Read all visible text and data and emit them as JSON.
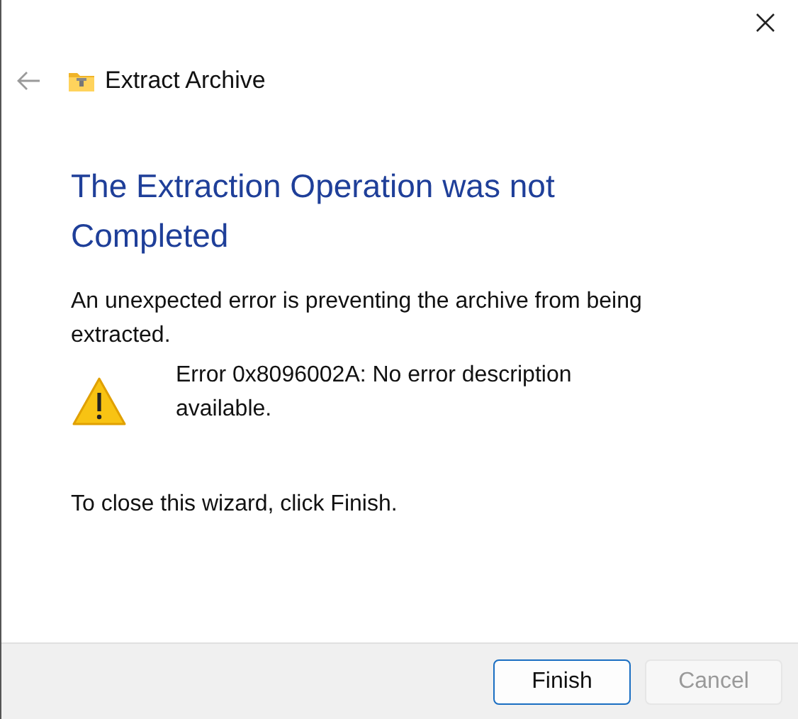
{
  "window": {
    "title": "Extract Archive",
    "back_disabled": true
  },
  "heading": "The Extraction Operation was not Completed",
  "message": "An unexpected error is preventing the archive from being extracted.",
  "error": {
    "kind": "warning",
    "text": "Error 0x8096002A: No error description available."
  },
  "instruction": "To close this wizard, click Finish.",
  "buttons": [
    {
      "label": "Finish",
      "default": true,
      "disabled": false
    },
    {
      "label": "Cancel",
      "default": false,
      "disabled": true
    }
  ]
}
